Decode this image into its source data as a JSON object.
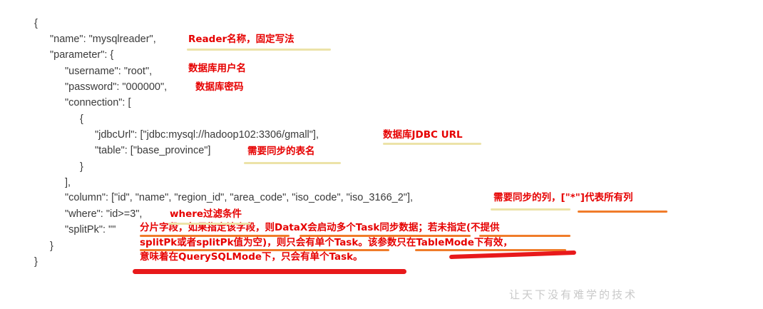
{
  "code_lines": [
    "{",
    "\"name\": \"mysqlreader\",",
    "\"parameter\": {",
    "\"username\": \"root\",",
    "\"password\": \"000000\",",
    "\"connection\": [",
    "{",
    "\"jdbcUrl\": [\"jdbc:mysql://hadoop102:3306/gmall\"],",
    "\"table\": [\"base_province\"]",
    "}",
    "],",
    "\"column\": [\"id\", \"name\", \"region_id\", \"area_code\", \"iso_code\", \"iso_3166_2\"],",
    "\"where\": \"id>=3\",",
    "\"splitPk\": \"\"",
    "}",
    "}"
  ],
  "annotations": {
    "name": "Reader名称，固定写法",
    "username": "数据库用户名",
    "password": "数据库密码",
    "jdbcUrl": "数据库JDBC URL",
    "table": "需要同步的表名",
    "column": "需要同步的列，[\"*\"]代表所有列",
    "where": "where过滤条件",
    "splitPk_line1": "分片字段，如果指定该字段，则DataX会启动多个Task同步数据；若未指定(不提供",
    "splitPk_line2": "splitPk或者splitPk值为空)，则只会有单个Task。该参数只在TableMode下有效，",
    "splitPk_line3": "意味着在QuerySQLMode下，只会有单个Task。"
  },
  "watermark": "让天下没有难学的技术",
  "colors": {
    "code": "#3a3a3a",
    "annotation": "#e60000",
    "highlight_yellow": "#ece3a8",
    "highlight_orange": "#f07c2a",
    "highlight_red": "#e8191b"
  }
}
